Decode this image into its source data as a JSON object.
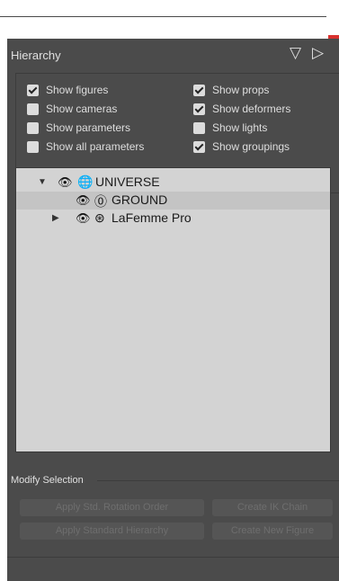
{
  "close_button": {
    "label": "×"
  },
  "panel": {
    "title": "Hierarchy"
  },
  "options": [
    {
      "label": "Show figures",
      "checked": true
    },
    {
      "label": "Show props",
      "checked": true
    },
    {
      "label": "Show cameras",
      "checked": false
    },
    {
      "label": "Show deformers",
      "checked": true
    },
    {
      "label": "Show parameters",
      "checked": false
    },
    {
      "label": "Show lights",
      "checked": false
    },
    {
      "label": "Show all parameters",
      "checked": false
    },
    {
      "label": "Show groupings",
      "checked": true
    }
  ],
  "tree": {
    "items": [
      {
        "label": "UNIVERSE",
        "expander": "▼",
        "node_icon": "universe-icon"
      },
      {
        "label": "GROUND",
        "expander": "",
        "node_icon": "ground-icon",
        "selected": true
      },
      {
        "label": "LaFemme Pro",
        "expander": "▶",
        "node_icon": "figure-icon"
      }
    ]
  },
  "modify": {
    "title": "Modify Selection",
    "buttons": [
      "Apply Std. Rotation Order",
      "Create IK Chain",
      "Apply Standard Hierarchy",
      "Create New Figure"
    ]
  }
}
